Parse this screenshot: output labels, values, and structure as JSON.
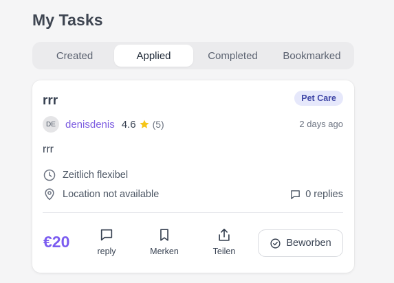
{
  "page": {
    "title": "My Tasks"
  },
  "tabs": [
    {
      "label": "Created",
      "active": false
    },
    {
      "label": "Applied",
      "active": true
    },
    {
      "label": "Completed",
      "active": false
    },
    {
      "label": "Bookmarked",
      "active": false
    }
  ],
  "task": {
    "title": "rrr",
    "category": "Pet Care",
    "user": {
      "initials": "DE",
      "name": "denisdenis",
      "rating": "4.6",
      "rating_count": "(5)"
    },
    "posted": "2 days ago",
    "description": "rrr",
    "schedule": "Zeitlich flexibel",
    "location": "Location not available",
    "replies": "0 replies",
    "price": "€20",
    "actions": {
      "reply": "reply",
      "bookmark": "Merken",
      "share": "Teilen"
    },
    "status_button": "Beworben"
  },
  "colors": {
    "accent": "#7b5cf0",
    "username": "#7c5ce0",
    "star": "#f5c518",
    "badge_bg": "#e6e8fb",
    "badge_text": "#3f46a6"
  },
  "icons": {
    "rating": "star-icon",
    "schedule": "clock-icon",
    "location": "location-pin-icon",
    "replies": "comment-icon",
    "reply": "comment-icon",
    "bookmark": "bookmark-icon",
    "share": "share-icon",
    "status": "check-circle-icon"
  }
}
